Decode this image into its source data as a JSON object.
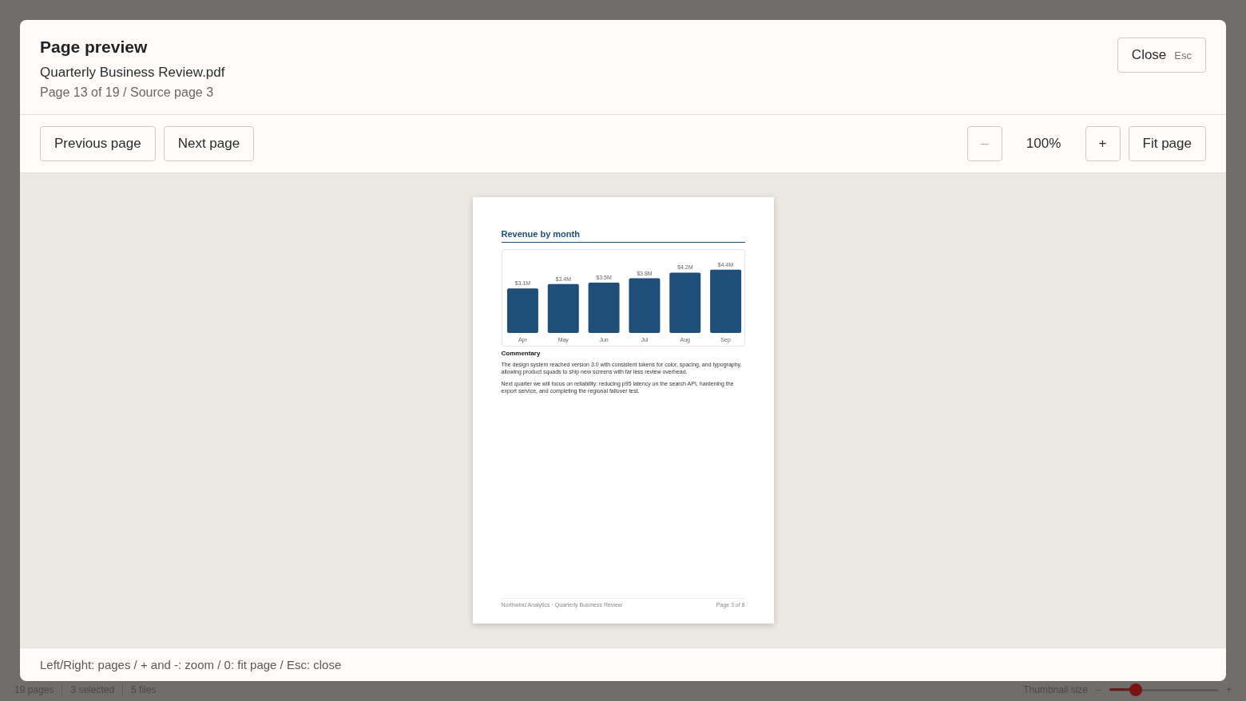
{
  "app_status_bar": {
    "items": [
      "19 pages",
      "3 selected",
      "5 files"
    ],
    "thumbnail_label": "Thumbnail size",
    "minus": "−",
    "plus": "+",
    "thumbnail_slider": {
      "level": 0.24
    }
  },
  "dialog": {
    "title": "Page preview",
    "file_name": "Quarterly Business Review.pdf",
    "page_info": "Page 13 of 19 / Source page 3",
    "close_button": {
      "label": "Close",
      "shortcut": "Esc"
    },
    "nav_buttons": [
      "Previous page",
      "Next page"
    ],
    "zoom": {
      "minus": "–",
      "value": "100%",
      "plus": "+",
      "fit": "Fit page",
      "minus_disabled": true
    },
    "page": {
      "heading": "Revenue by month",
      "chart_data": {
        "type": "bar",
        "categories": [
          "Apr",
          "May",
          "Jun",
          "Jul",
          "Aug",
          "Sep"
        ],
        "series": [
          {
            "color": "#1f4e79",
            "values": [
              3.1,
              3.4,
              3.5,
              3.8,
              4.2,
              4.4
            ],
            "value_labels": [
              "$3.1M",
              "$3.4M",
              "$3.5M",
              "$3.8M",
              "$4.2M",
              "$4.4M"
            ]
          }
        ]
      },
      "subheading": "Commentary",
      "paragraphs": [
        "The design system reached version 3.0 with consistent tokens for color, spacing, and typography, allowing product squads to ship new screens with far less review overhead.",
        "Next quarter we will focus on reliability: reducing p95 latency on the search API, hardening the export service, and completing the regional failover test."
      ],
      "footer_left": "Northwind Analytics · Quarterly Business Review",
      "footer_right": "Page 3 of 8"
    },
    "hint": "Left/Right: pages / + and -: zoom / 0: fit page / Esc: close"
  }
}
